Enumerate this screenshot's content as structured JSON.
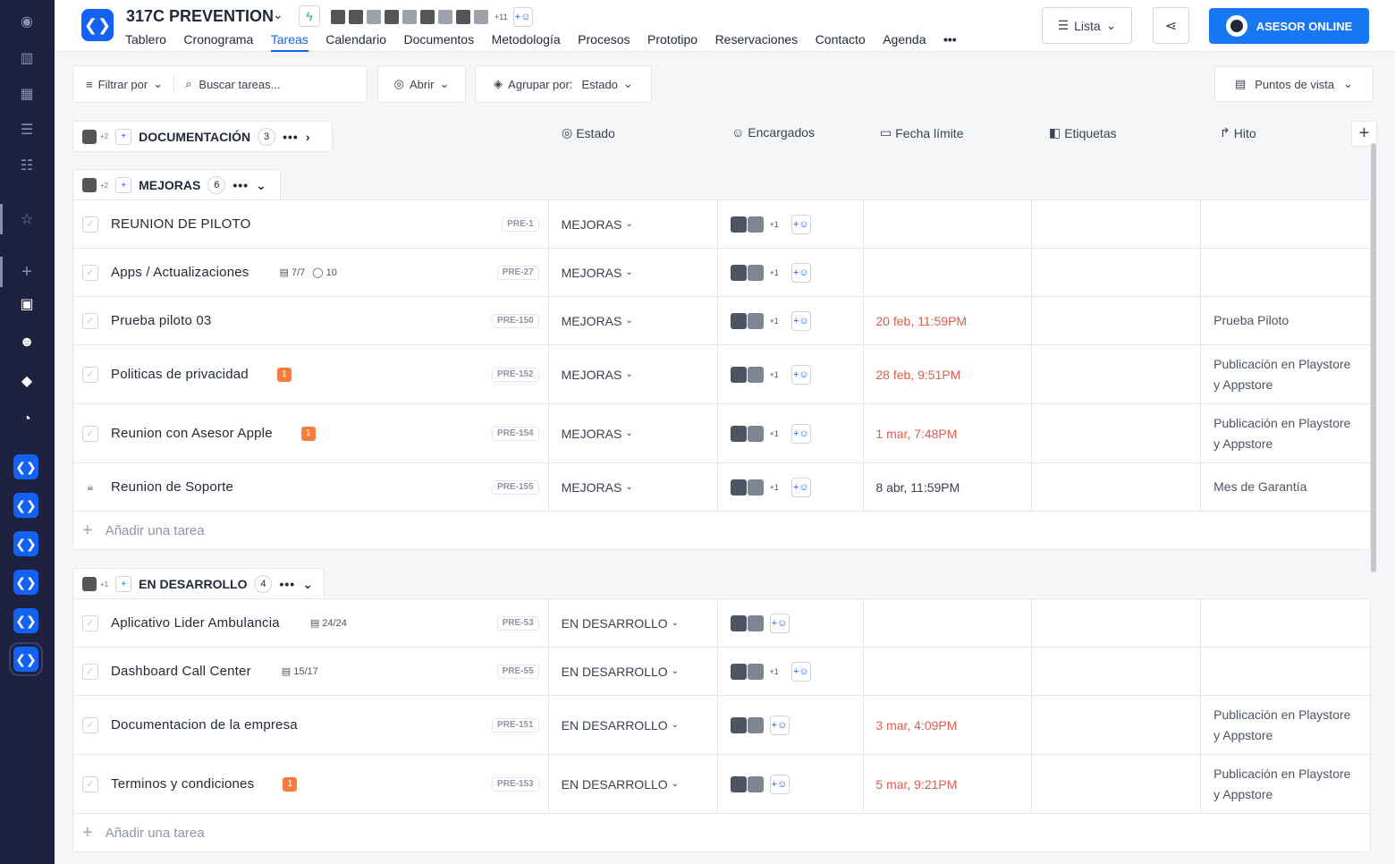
{
  "project": {
    "title": "317C PREVENTION",
    "more_members": "+11"
  },
  "nav": {
    "tabs": [
      "Tablero",
      "Cronograma",
      "Tareas",
      "Calendario",
      "Documentos",
      "Metodología",
      "Procesos",
      "Prototipo",
      "Reservaciones",
      "Contacto",
      "Agenda"
    ],
    "active": "Tareas",
    "more": "•••"
  },
  "header": {
    "view_label": "Lista",
    "asesor_label": "ASESOR ONLINE"
  },
  "toolbar": {
    "filter_label": "Filtrar por",
    "search_placeholder": "Buscar tareas...",
    "open_label": "Abrir",
    "group_label": "Agrupar por:",
    "group_value": "Estado",
    "views_label": "Puntos de vista"
  },
  "columns": {
    "estado": "Estado",
    "encargados": "Encargados",
    "fecha": "Fecha límite",
    "etiquetas": "Etiquetas",
    "hito": "Hito"
  },
  "groups": [
    {
      "name": "DOCUMENTACIÓN",
      "count": "3",
      "extra": "+2",
      "collapsed": true
    },
    {
      "name": "MEJORAS",
      "count": "6",
      "extra": "+2",
      "add_task": "Añadir una tarea",
      "tasks": [
        {
          "name": "REUNION DE PILOTO",
          "code": "PRE-1",
          "estado": "MEJORAS",
          "plus": "+1",
          "fecha": "",
          "hito": ""
        },
        {
          "name": "Apps / Actualizaciones",
          "meta1": "7/7",
          "meta2": "10",
          "code": "PRE-27",
          "estado": "MEJORAS",
          "plus": "+1",
          "fecha": "",
          "hito": ""
        },
        {
          "name": "Prueba piloto 03",
          "code": "PRE-150",
          "estado": "MEJORAS",
          "plus": "+1",
          "fecha": "20 feb, 11:59PM",
          "overdue": true,
          "hito": "Prueba Piloto"
        },
        {
          "name": "Politicas de privacidad",
          "badge": "1",
          "code": "PRE-152",
          "estado": "MEJORAS",
          "plus": "+1",
          "fecha": "28 feb, 9:51PM",
          "overdue": true,
          "hito": "Publicación en Playstore y Appstore"
        },
        {
          "name": "Reunion con Asesor Apple",
          "badge": "1",
          "code": "PRE-154",
          "estado": "MEJORAS",
          "plus": "+1",
          "fecha": "1 mar, 7:48PM",
          "overdue": true,
          "hito": "Publicación en Playstore y Appstore"
        },
        {
          "name": "Reunion de Soporte",
          "code": "PRE-155",
          "estado": "MEJORAS",
          "plus": "+1",
          "fecha": "8 abr, 11:59PM",
          "overdue": false,
          "hito": "Mes de Garantía",
          "locked": true
        }
      ]
    },
    {
      "name": "EN DESARROLLO",
      "count": "4",
      "extra": "+1",
      "add_task": "Añadir una tarea",
      "tasks": [
        {
          "name": "Aplicativo Lider Ambulancia",
          "meta1": "24/24",
          "code": "PRE-53",
          "estado": "EN DESARROLLO",
          "plus": "",
          "fecha": "",
          "hito": ""
        },
        {
          "name": "Dashboard Call Center",
          "meta1": "15/17",
          "code": "PRE-55",
          "estado": "EN DESARROLLO",
          "plus": "+1",
          "fecha": "",
          "hito": ""
        },
        {
          "name": "Documentacion de la empresa",
          "code": "PRE-151",
          "estado": "EN DESARROLLO",
          "plus": "",
          "fecha": "3 mar, 4:09PM",
          "overdue": true,
          "hito": "Publicación en Playstore y Appstore"
        },
        {
          "name": "Terminos y condiciones",
          "badge": "1",
          "code": "PRE-153",
          "estado": "EN DESARROLLO",
          "plus": "",
          "fecha": "5 mar, 9:21PM",
          "overdue": true,
          "hito": "Publicación en Playstore y Appstore"
        }
      ]
    }
  ],
  "colors": {
    "accent": "#1462f5",
    "overdue": "#e35b4b",
    "badge": "#f97c3c",
    "sidebar": "#1e2140"
  }
}
